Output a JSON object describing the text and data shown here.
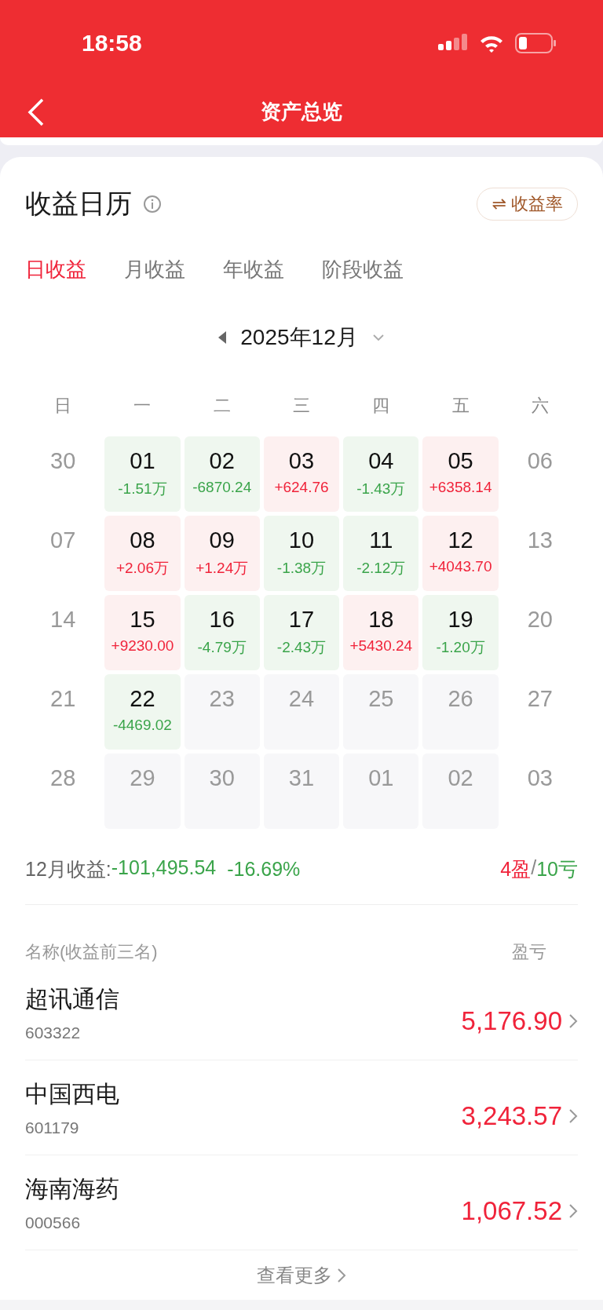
{
  "status_bar": {
    "time": "18:58"
  },
  "nav": {
    "title": "资产总览"
  },
  "card": {
    "title": "收益日历",
    "toggle": "⇌ 收益率"
  },
  "tabs": [
    {
      "label": "日收益",
      "selected": true
    },
    {
      "label": "月收益",
      "selected": false
    },
    {
      "label": "年收益",
      "selected": false
    },
    {
      "label": "阶段收益",
      "selected": false
    }
  ],
  "month": {
    "label": "2025年12月"
  },
  "weekdays": [
    "日",
    "一",
    "二",
    "三",
    "四",
    "五",
    "六"
  ],
  "weeks": [
    [
      {
        "day": "30",
        "kind": "plain"
      },
      {
        "day": "01",
        "kind": "loss",
        "value": "-1.51万"
      },
      {
        "day": "02",
        "kind": "loss",
        "value": "-6870.24"
      },
      {
        "day": "03",
        "kind": "gain",
        "value": "+624.76"
      },
      {
        "day": "04",
        "kind": "loss",
        "value": "-1.43万"
      },
      {
        "day": "05",
        "kind": "gain",
        "value": "+6358.14"
      },
      {
        "day": "06",
        "kind": "plain"
      }
    ],
    [
      {
        "day": "07",
        "kind": "plain"
      },
      {
        "day": "08",
        "kind": "gain",
        "value": "+2.06万"
      },
      {
        "day": "09",
        "kind": "gain",
        "value": "+1.24万"
      },
      {
        "day": "10",
        "kind": "loss",
        "value": "-1.38万"
      },
      {
        "day": "11",
        "kind": "loss",
        "value": "-2.12万"
      },
      {
        "day": "12",
        "kind": "gain",
        "value": "+4043.70"
      },
      {
        "day": "13",
        "kind": "plain"
      }
    ],
    [
      {
        "day": "14",
        "kind": "plain"
      },
      {
        "day": "15",
        "kind": "gain",
        "value": "+9230.00"
      },
      {
        "day": "16",
        "kind": "loss",
        "value": "-4.79万"
      },
      {
        "day": "17",
        "kind": "loss",
        "value": "-2.43万"
      },
      {
        "day": "18",
        "kind": "gain",
        "value": "+5430.24"
      },
      {
        "day": "19",
        "kind": "loss",
        "value": "-1.20万"
      },
      {
        "day": "20",
        "kind": "plain"
      }
    ],
    [
      {
        "day": "21",
        "kind": "plain"
      },
      {
        "day": "22",
        "kind": "loss",
        "value": "-4469.02"
      },
      {
        "day": "23",
        "kind": "pending"
      },
      {
        "day": "24",
        "kind": "pending"
      },
      {
        "day": "25",
        "kind": "pending"
      },
      {
        "day": "26",
        "kind": "pending"
      },
      {
        "day": "27",
        "kind": "plain"
      }
    ],
    [
      {
        "day": "28",
        "kind": "plain"
      },
      {
        "day": "29",
        "kind": "pending"
      },
      {
        "day": "30",
        "kind": "pending"
      },
      {
        "day": "31",
        "kind": "pending"
      },
      {
        "day": "01",
        "kind": "pending"
      },
      {
        "day": "02",
        "kind": "pending"
      },
      {
        "day": "03",
        "kind": "plain"
      }
    ]
  ],
  "summary": {
    "label": "12月收益:",
    "amount": "-101,495.54",
    "percent": "-16.69%",
    "wins": "4盈",
    "separator": "/",
    "losses": "10亏"
  },
  "table": {
    "columns": [
      "名称(收益前三名)",
      "盈亏"
    ],
    "rows": [
      {
        "name": "超讯通信",
        "code": "603322",
        "pnl": "5,176.90"
      },
      {
        "name": "中国西电",
        "code": "601179",
        "pnl": "3,243.57"
      },
      {
        "name": "海南海药",
        "code": "000566",
        "pnl": "1,067.52"
      }
    ]
  },
  "more": "查看更多"
}
